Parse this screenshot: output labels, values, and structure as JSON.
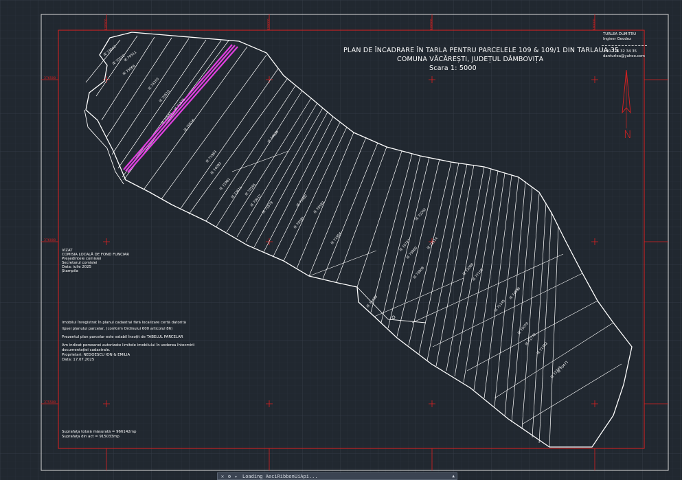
{
  "drawing": {
    "title_line1": "PLAN DE ÎNCADRARE ÎN TARLA PENTRU PARCELELE 109 & 109/1 DIN TARLAUA 35",
    "title_line2": "COMUNA VĂCĂREȘTI, JUDEȚUL DÂMBOVIȚA",
    "scale": "Scara 1: 5000"
  },
  "surveyor": {
    "name": "TURLEA DUMITRU",
    "role": "Inginer Geodez",
    "phone": "+40 726 32 34 35",
    "email": "danturlea@yahoo.com"
  },
  "approval": {
    "lines": [
      "VIZAT",
      "COMISIA LOCALĂ DE FOND FUNCIAR",
      "Președintele comisiei",
      "Secretarul comisiei",
      "Data: iulie 2025",
      "Ștampila"
    ]
  },
  "notes": {
    "lines": [
      "Imobilul înregistrat în planul cadastral fără localizare certă datorită",
      "lipsei planului parcelar, (conform Ordinului 600 articolul 86)",
      "",
      "Prezentul plan parcelar este valabil însoțit de TABELUL PARCELAR",
      "",
      "Am indicat persoanei autorizate limitele imobilului în vederea întocmirii",
      "documentației cadastrale.",
      "Proprietari: NEGOESCU ION & EMILIA",
      "Data: 17.07.2025"
    ]
  },
  "areas": {
    "measured": "Suprafața totală măsurată = 966142mp",
    "act": "Suprafața din act =  915033mp"
  },
  "grid_labels": {
    "top": [
      "328500",
      "329000",
      "329500",
      "330000"
    ],
    "left": [
      "376500",
      "376000",
      "375500"
    ]
  },
  "parcel_labels": [
    "IE 73843",
    "IE 70510",
    "IE 70511",
    "IE 75066",
    "IE 74350",
    "IE 70510",
    "IE 71876",
    "IE 70541",
    "IE 70516",
    "IE 71963",
    "IE 74093",
    "IE 74608",
    "IE 72981",
    "IE 73611",
    "IE 70595",
    "IE 73017",
    "IE 71979",
    "IE 71982",
    "IE 70591",
    "IE 70583",
    "IE 71954",
    "IE 75262",
    "IE 70727",
    "IE 73880",
    "IE 71114",
    "IE 73908",
    "IE 72088",
    "IE 77158",
    "IE 71145",
    "IE 74598",
    "IE 75070",
    "IE 71778",
    "IE 71352",
    "IE 72345",
    "IE 70471",
    "IE 71408"
  ],
  "north_label": "N",
  "command_line": {
    "text": "Loading AeciRibbonUiApi...",
    "buttons": [
      "close-command-line",
      "customize",
      "recent-commands"
    ]
  },
  "colors": {
    "background": "#212830",
    "grid": "#2f3740",
    "frame": "#e02020",
    "linework": "#ffffff",
    "highlight": "#e040e0"
  }
}
